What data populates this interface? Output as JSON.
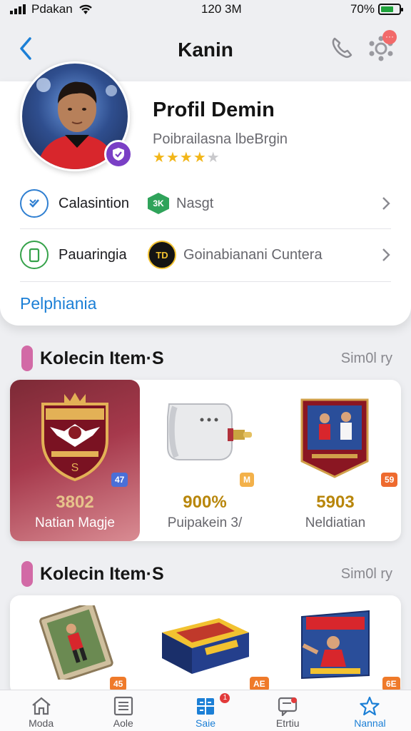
{
  "status_bar": {
    "carrier": "Pdakan",
    "time": "120 3M",
    "battery": "70%",
    "battery_level": 0.7
  },
  "header": {
    "title": "Kanin",
    "back_icon": "chevron-left-icon",
    "call_icon": "phone-icon",
    "settings_icon": "gear-icon",
    "settings_badge": "···"
  },
  "profile": {
    "name": "Profil Demin",
    "subtitle": "Poibrailasna lbeBrgin",
    "rating": 4,
    "rating_max": 5,
    "rows": [
      {
        "label": "Calasintion",
        "icon": "check-circle-icon",
        "mid_badge": "3K",
        "mid_text": "Nasgt"
      },
      {
        "label": "Pauaringia",
        "icon": "phone-frame-icon",
        "mid_badge": "TD",
        "mid_text": "Goinabianani Cuntera"
      }
    ],
    "link": "Pelphiania"
  },
  "sections": [
    {
      "title": "Kolecin Item·S",
      "more": "Sim0l ry",
      "items": [
        {
          "value": "3802",
          "name": "Natian Magje",
          "tag": "47",
          "tag_color": "#4a6fd8",
          "art": "crest-icon"
        },
        {
          "value": "900%",
          "name": "Puipakein 3/",
          "tag": "M",
          "tag_color": "#f3b14a",
          "art": "device-icon"
        },
        {
          "value": "5903",
          "name": "Neldiatian",
          "tag": "59",
          "tag_color": "#ee6a2e",
          "art": "card-icon"
        }
      ]
    },
    {
      "title": "Kolecin Item·S",
      "more": "Sim0l ry",
      "items": [
        {
          "value": "",
          "name": "",
          "tag": "45",
          "tag_color": "#ef7a2a",
          "art": "photo-card-icon"
        },
        {
          "value": "",
          "name": "",
          "tag": "AE",
          "tag_color": "#ef7a2a",
          "art": "box-icon"
        },
        {
          "value": "",
          "name": "",
          "tag": "6E",
          "tag_color": "#ef7a2a",
          "art": "game-box-icon"
        }
      ]
    }
  ],
  "nav": [
    {
      "label": "Moda",
      "icon": "home-icon"
    },
    {
      "label": "Aole",
      "icon": "list-icon"
    },
    {
      "label": "Saie",
      "icon": "grid-icon",
      "badge": "1"
    },
    {
      "label": "Etrtiu",
      "icon": "message-icon"
    },
    {
      "label": "Nannal",
      "icon": "star-icon"
    }
  ],
  "colors": {
    "accent": "#1b7fd6",
    "featured": "#a6394c",
    "pill": "#d26aa6"
  }
}
